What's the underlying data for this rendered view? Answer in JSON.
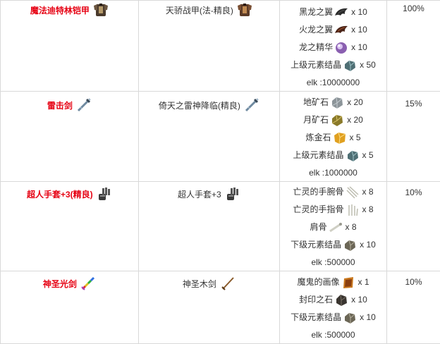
{
  "rows": [
    {
      "target": {
        "name": "魔法迪特林铠甲",
        "icon": "armor-icon"
      },
      "source": {
        "name": "天骄战甲(法-精良)",
        "icon": "armor-icon"
      },
      "materials": [
        {
          "name": "黑龙之翼",
          "qty": "x 10",
          "icon": "black-wing-icon"
        },
        {
          "name": "火龙之翼",
          "qty": "x 10",
          "icon": "fire-wing-icon"
        },
        {
          "name": "龙之精华",
          "qty": "x 10",
          "icon": "purple-orb-icon"
        },
        {
          "name": "上级元素结晶",
          "qty": "x 50",
          "icon": "crystal-icon"
        }
      ],
      "cost": "elk :10000000",
      "rate": "100%"
    },
    {
      "target": {
        "name": "雷击剑",
        "icon": "sword-icon"
      },
      "source": {
        "name": "倚天之雷神降临(精良)",
        "icon": "sword-icon"
      },
      "materials": [
        {
          "name": "地矿石",
          "qty": "x 20",
          "icon": "grey-ore-icon"
        },
        {
          "name": "月矿石",
          "qty": "x 20",
          "icon": "moon-ore-icon"
        },
        {
          "name": "炼金石",
          "qty": "x 5",
          "icon": "gold-stone-icon"
        },
        {
          "name": "上级元素结晶",
          "qty": "x 5",
          "icon": "crystal-icon"
        }
      ],
      "cost": "elk :1000000",
      "rate": "15%"
    },
    {
      "target": {
        "name": "超人手套+3(精良)",
        "icon": "gauntlet-icon"
      },
      "source": {
        "name": "超人手套+3",
        "icon": "gauntlet-icon"
      },
      "materials": [
        {
          "name": "亡灵的手腕骨",
          "qty": "x 8",
          "icon": "wrist-bone-icon"
        },
        {
          "name": "亡灵的手指骨",
          "qty": "x 8",
          "icon": "finger-bone-icon"
        },
        {
          "name": "肩骨",
          "qty": "x 8",
          "icon": "shoulder-bone-icon"
        },
        {
          "name": "下级元素结晶",
          "qty": "x 10",
          "icon": "lower-crystal-icon"
        }
      ],
      "cost": "elk :500000",
      "rate": "10%"
    },
    {
      "target": {
        "name": "神圣光剑",
        "icon": "rainbow-sword-icon"
      },
      "source": {
        "name": "神圣木剑",
        "icon": "wooden-sword-icon"
      },
      "materials": [
        {
          "name": "魔鬼的画像",
          "qty": "x 1",
          "icon": "portrait-icon"
        },
        {
          "name": "封印之石",
          "qty": "x 10",
          "icon": "seal-stone-icon"
        },
        {
          "name": "下级元素结晶",
          "qty": "x 10",
          "icon": "lower-crystal-icon"
        }
      ],
      "cost": "elk :500000",
      "rate": "10%"
    }
  ],
  "colors": {
    "target_name": "#e60012",
    "text": "#333333",
    "border": "#d9d9d9"
  }
}
